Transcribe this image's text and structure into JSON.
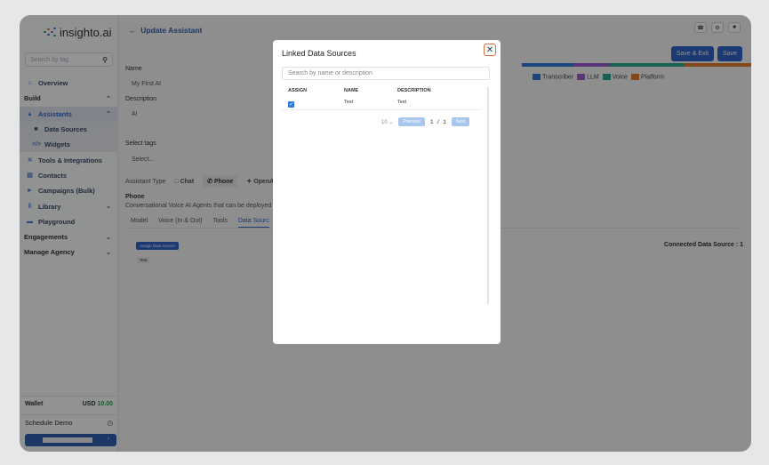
{
  "brand": {
    "name": "insighto.ai"
  },
  "sidebar": {
    "search_placeholder": "Search by tag",
    "items": [
      {
        "label": "Overview",
        "icon": "home-icon"
      },
      {
        "label": "Build"
      },
      {
        "label": "Assistants",
        "icon": "robot-icon"
      },
      {
        "label": "Data Sources",
        "icon": "database-icon"
      },
      {
        "label": "Widgets",
        "icon": "code-icon"
      },
      {
        "label": "Tools & Integrations",
        "icon": "tools-icon"
      },
      {
        "label": "Contacts",
        "icon": "contacts-icon"
      },
      {
        "label": "Campaigns (Bulk)",
        "icon": "megaphone-icon"
      },
      {
        "label": "Library",
        "icon": "library-icon"
      },
      {
        "label": "Playground",
        "icon": "play-icon"
      },
      {
        "label": "Engagements"
      },
      {
        "label": "Manage Agency"
      }
    ],
    "wallet_label": "Wallet",
    "wallet_currency": "USD",
    "wallet_amount": "10.00",
    "schedule_demo": "Schedule Demo"
  },
  "header": {
    "title": "Update Assistant",
    "save_exit": "Save & Exit",
    "save": "Save"
  },
  "form": {
    "name_label": "Name",
    "name_value": "My First AI",
    "description_label": "Description",
    "description_value": "AI",
    "tags_label": "Select tags",
    "tags_placeholder": "Select...",
    "type_label": "Assistant Type",
    "types": [
      "Chat",
      "Phone",
      "OpenAI"
    ],
    "phone_title": "Phone",
    "phone_desc": "Conversational Voice AI Agents that can be deployed o",
    "tabs": [
      "Model",
      "Voice (In & Out)",
      "Tools",
      "Data Sourc"
    ],
    "assign_button": "Assign Data Source",
    "chip": "Test",
    "connected": "Connected Data Source : 1"
  },
  "cost": {
    "legend": [
      "Transcriber",
      "LLM",
      "Voice",
      "Platform"
    ],
    "colors": [
      "#2f78d8",
      "#9b59d0",
      "#2aa58f",
      "#e07a2e"
    ]
  },
  "modal": {
    "title": "Linked Data Sources",
    "search_placeholder": "Search by name or description",
    "columns": [
      "ASSIGN",
      "NAME",
      "DESCRIPTION"
    ],
    "rows": [
      {
        "name": "Test",
        "description": "Test",
        "checked": true
      }
    ],
    "page_size": "10",
    "previous": "Previous",
    "page_current": "1",
    "page_sep": "/",
    "page_total": "1",
    "next": "Next"
  }
}
